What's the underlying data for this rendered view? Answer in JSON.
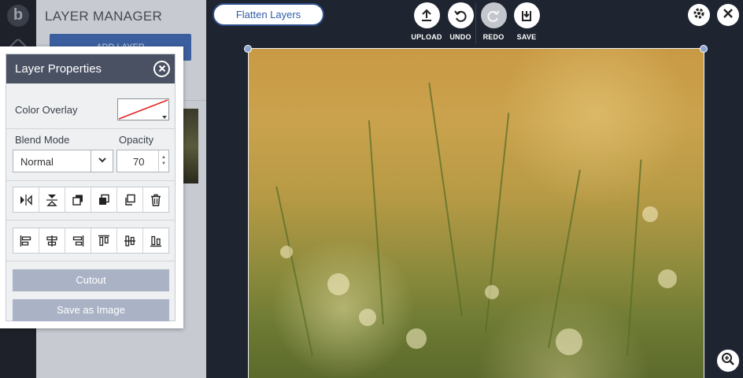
{
  "sidebar": {
    "logo_glyph": "b"
  },
  "layer_manager": {
    "title": "LAYER MANAGER",
    "add_layer_label": "ADD LAYER"
  },
  "toolbar": {
    "flatten_label": "Flatten Layers",
    "upload_label": "UPLOAD",
    "undo_label": "UNDO",
    "redo_label": "REDO",
    "save_label": "SAVE",
    "redo_disabled": true
  },
  "layer_properties": {
    "title": "Layer Properties",
    "color_overlay_label": "Color Overlay",
    "blend_mode_label": "Blend Mode",
    "blend_mode_value": "Normal",
    "opacity_label": "Opacity",
    "opacity_value": "70",
    "transform_icons": [
      "flip-horizontal-icon",
      "flip-vertical-icon",
      "bring-forward-icon",
      "bring-to-front-icon",
      "duplicate-icon",
      "trash-icon"
    ],
    "align_icons": [
      "align-left-icon",
      "align-center-horizontal-icon",
      "align-right-icon",
      "align-top-icon",
      "align-center-vertical-icon",
      "align-bottom-icon"
    ],
    "cutout_label": "Cutout",
    "save_as_image_label": "Save as Image"
  },
  "colors": {
    "header_bg": "#4a5163",
    "accent_blue": "#2f5ea8",
    "workspace_bg": "#1e2430",
    "disabled_button": "#aab3c5"
  }
}
